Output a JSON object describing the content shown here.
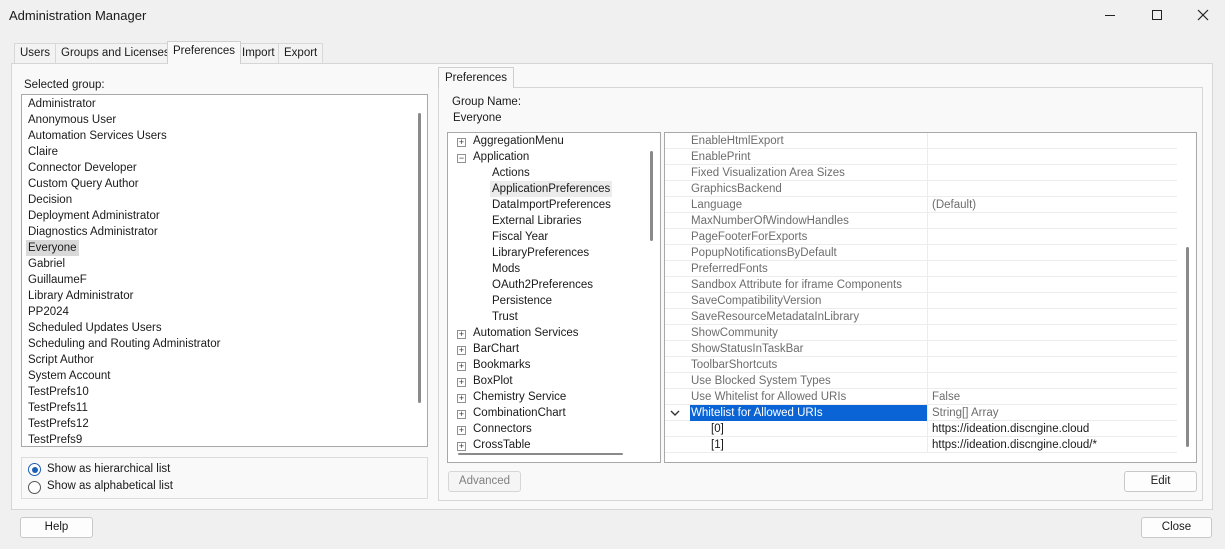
{
  "window": {
    "title": "Administration Manager"
  },
  "tabs": [
    "Users",
    "Groups and Licenses",
    "Preferences",
    "Import",
    "Export"
  ],
  "left": {
    "selected_group_label": "Selected group:",
    "groups": [
      "Administrator",
      "Anonymous User",
      "Automation Services Users",
      "Claire",
      "Connector Developer",
      "Custom Query Author",
      "Decision",
      "Deployment Administrator",
      "Diagnostics Administrator",
      "Everyone",
      "Gabriel",
      "GuillaumeF",
      "Library Administrator",
      "PP2024",
      "Scheduled Updates Users",
      "Scheduling and Routing Administrator",
      "Script Author",
      "System Account",
      "TestPrefs10",
      "TestPrefs11",
      "TestPrefs12",
      "TestPrefs9"
    ],
    "selected_group": "Everyone",
    "radio_hierarchical": "Show as hierarchical list",
    "radio_alphabetical": "Show as alphabetical list"
  },
  "right": {
    "tab_label": "Preferences",
    "group_name_label": "Group Name:",
    "group_name_value": "Everyone",
    "tree": [
      {
        "label": "AggregationMenu",
        "level": 0,
        "expander": "+"
      },
      {
        "label": "Application",
        "level": 0,
        "expander": "-"
      },
      {
        "label": "Actions",
        "level": 1
      },
      {
        "label": "ApplicationPreferences",
        "level": 1,
        "selected": true
      },
      {
        "label": "DataImportPreferences",
        "level": 1
      },
      {
        "label": "External Libraries",
        "level": 1
      },
      {
        "label": "Fiscal Year",
        "level": 1
      },
      {
        "label": "LibraryPreferences",
        "level": 1
      },
      {
        "label": "Mods",
        "level": 1
      },
      {
        "label": "OAuth2Preferences",
        "level": 1
      },
      {
        "label": "Persistence",
        "level": 1
      },
      {
        "label": "Trust",
        "level": 1
      },
      {
        "label": "Automation Services",
        "level": 0,
        "expander": "+"
      },
      {
        "label": "BarChart",
        "level": 0,
        "expander": "+"
      },
      {
        "label": "Bookmarks",
        "level": 0,
        "expander": "+"
      },
      {
        "label": "BoxPlot",
        "level": 0,
        "expander": "+"
      },
      {
        "label": "Chemistry Service",
        "level": 0,
        "expander": "+"
      },
      {
        "label": "CombinationChart",
        "level": 0,
        "expander": "+"
      },
      {
        "label": "Connectors",
        "level": 0,
        "expander": "+"
      },
      {
        "label": "CrossTable",
        "level": 0,
        "expander": "+"
      }
    ],
    "properties": [
      {
        "name": "EnableHtmlExport",
        "value": ""
      },
      {
        "name": "EnablePrint",
        "value": ""
      },
      {
        "name": "Fixed Visualization Area Sizes",
        "value": ""
      },
      {
        "name": "GraphicsBackend",
        "value": ""
      },
      {
        "name": "Language",
        "value": "(Default)"
      },
      {
        "name": "MaxNumberOfWindowHandles",
        "value": ""
      },
      {
        "name": "PageFooterForExports",
        "value": ""
      },
      {
        "name": "PopupNotificationsByDefault",
        "value": ""
      },
      {
        "name": "PreferredFonts",
        "value": ""
      },
      {
        "name": "Sandbox Attribute for iframe Components",
        "value": ""
      },
      {
        "name": "SaveCompatibilityVersion",
        "value": ""
      },
      {
        "name": "SaveResourceMetadataInLibrary",
        "value": ""
      },
      {
        "name": "ShowCommunity",
        "value": ""
      },
      {
        "name": "ShowStatusInTaskBar",
        "value": ""
      },
      {
        "name": "ToolbarShortcuts",
        "value": ""
      },
      {
        "name": "Use Blocked System Types",
        "value": ""
      },
      {
        "name": "Use Whitelist for Allowed URIs",
        "value": "False"
      },
      {
        "name": "Whitelist for Allowed URIs",
        "value": "String[] Array",
        "selected": true,
        "expanded": true
      },
      {
        "name": "[0]",
        "value": "https://ideation.discngine.cloud",
        "child": true
      },
      {
        "name": "[1]",
        "value": "https://ideation.discngine.cloud/*",
        "child": true
      }
    ],
    "advanced_button": "Advanced",
    "edit_button": "Edit"
  },
  "footer": {
    "help_button": "Help",
    "close_button": "Close"
  },
  "colors": {
    "selection_blue": "#0a64d6",
    "list_selection": "#d9d9d9",
    "radio_accent": "#1a5fb4"
  },
  "icons": [
    "minimize-icon",
    "maximize-icon",
    "close-icon",
    "expand-plus-icon",
    "collapse-minus-icon",
    "chevron-down-icon"
  ]
}
